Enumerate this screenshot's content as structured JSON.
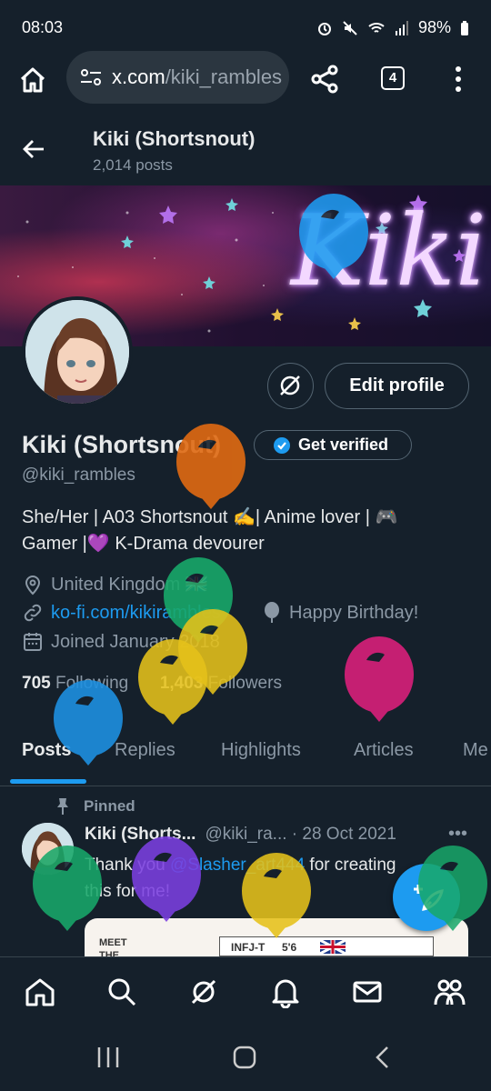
{
  "status_bar": {
    "time": "08:03",
    "battery": "98%"
  },
  "browser": {
    "url_host": "x.com",
    "url_path": "/kiki_rambles",
    "tab_count": "4"
  },
  "header": {
    "title": "Kiki (Shortsnout)",
    "post_count": "2,014 posts"
  },
  "banner": {
    "text": "Kiki"
  },
  "profile": {
    "edit_label": "Edit profile",
    "display_name": "Kiki (Shortsnout)",
    "verify_label": "Get verified",
    "handle": "@kiki_rambles",
    "bio_line1": "She/Her | A03 Shortsnout ✍️| Anime lover | 🎮",
    "bio_line2": "Gamer |💜 K-Drama devourer",
    "location": "United Kingdom 🇬🇧",
    "website": "ko-fi.com/kikirambles",
    "birthday": "Happy Birthday!",
    "joined": "Joined January 2018",
    "following_count": "705",
    "following_label": "Following",
    "followers_count": "1,403",
    "followers_label": "Followers"
  },
  "tabs": [
    "Posts",
    "Replies",
    "Highlights",
    "Articles",
    "Me"
  ],
  "tweet": {
    "pinned_label": "Pinned",
    "name": "Kiki (Shorts...",
    "meta": "@kiki_ra... · 28 Oct 2021",
    "text_before": "Thank you ",
    "mention": "@Slasher_art444",
    "text_after": " for creating this for me!",
    "media_meet": "MEET THE",
    "media_type": "INFJ-T",
    "media_height": "5'6"
  },
  "colors": {
    "accent": "#1d9bf0",
    "background": "#15202b",
    "muted": "#8b98a5",
    "border": "#536471"
  },
  "icons": [
    "home-icon",
    "site-settings-icon",
    "share-icon",
    "more-icon",
    "back-icon",
    "grok-icon",
    "verified-icon",
    "location-icon",
    "link-icon",
    "balloon-icon",
    "calendar-icon",
    "pin-icon",
    "compose-icon",
    "search-icon",
    "notifications-icon",
    "messages-icon",
    "communities-icon"
  ]
}
